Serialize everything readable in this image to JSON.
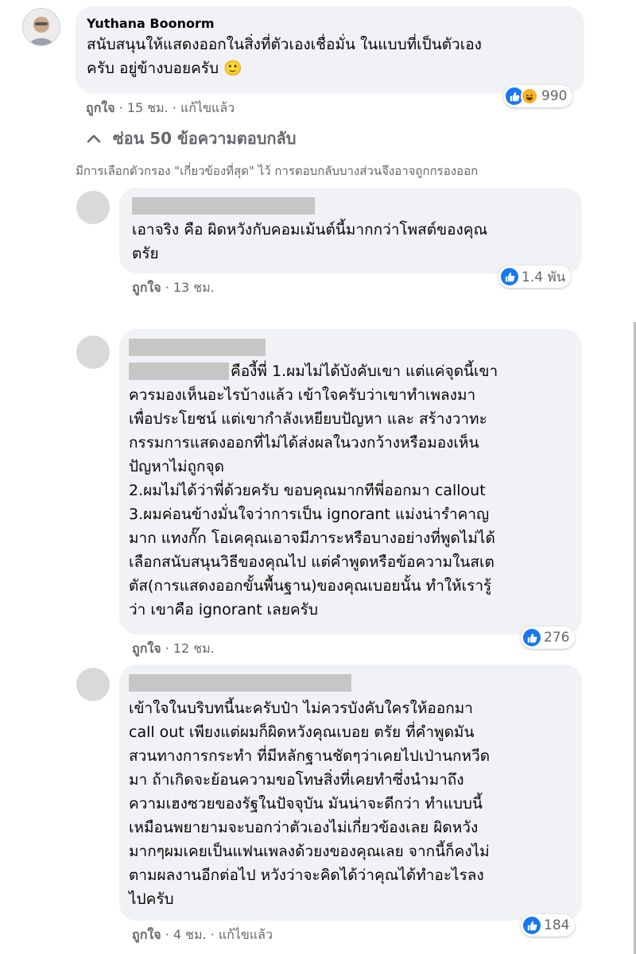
{
  "main_comment": {
    "author": "Yuthana Boonorm",
    "text": "สนับสนุนให้แสดงออกในสิ่งที่ตัวเองเชื่อมั่น ในแบบที่เป็นตัวเอง\nครับ อยู่ข้างบอยครับ",
    "emoji": "🙂",
    "like_label": "ถูกใจ",
    "time": "15 ชม.",
    "edited_label": "แก้ไขแล้ว",
    "reaction_count": "990",
    "reaction_icons": [
      "like-icon",
      "haha-icon"
    ]
  },
  "hide_replies_label": "ซ่อน 50 ข้อความตอบกลับ",
  "filter_note": "มีการเลือกตัวกรอง \"เกี่ยวข้องที่สุด\" ไว้ การตอบกลับบางส่วนจึงอาจถูกกรองออก",
  "replies": [
    {
      "text": "เอาจริง คือ ผิดหวังกับคอมเม้นต์นี้มากกว่าโพสต์ของคุณ\nตรัย",
      "like_label": "ถูกใจ",
      "time": "13 ชม.",
      "reaction_count": "1.4 พัน"
    },
    {
      "text_first": "คืองี้พี่ 1.ผมไม่ได้บังคับเขา แต่แค่จุดนี้เขา",
      "text": "ควรมองเห็นอะไรบ้างแล้ว เข้าใจครับว่าเขาทำเพลงมา\nเพื่อประโยชน์ แต่เขากำลังเหยียบปัญหา และ สร้างวาทะ\nกรรมการแสดงออกที่ไม่ได้ส่งผลในวงกว้างหรือมองเห็น\nปัญหาไม่ถูกจุด\n2.ผมไม่ได้ว่าพี่ด้วยครับ ขอบคุณมากทีพี่ออกมา callout\n3.ผมค่อนข้างมั่นใจว่าการเป็น ignorant แม่งน่ารำคาญ\nมาก แทงกั๊ก โอเคคุณเอาจมีภาระหรือบางอย่างที่พูดไม่ได้\nเลือกสนับสนุนวิธีของคุณไป แต่คำพูดหรือข้อความในสเต\nตัส(การแสดงออกขั้นพื้นฐาน)ของคุณเบอยนั้น ทำให้เรารู้\nว่า เขาคือ ignorant เลยครับ",
      "like_label": "ถูกใจ",
      "time": "12 ชม.",
      "reaction_count": "276"
    },
    {
      "text": "เข้าใจในบริบทนี้นะครับป๋า ไม่ควรบังคับใครให้ออกมา\ncall out เพียงแต่ผมก็ผิดหวังคุณเบอย ตรัย ที่คำพูดมัน\nสวนทางการกระทำ ที่มีหลักฐานชัดๆว่าเคยไปเป่านกหวีด\nมา ถ้าเกิดจะย้อนความขอโทษสิ่งที่เคยทำซึ่งนำมาถึง\nความเฮงซวยของรัฐในปัจจุบัน มันน่าจะดีกว่า ทำแบบนี้\nเหมือนพยายามจะบอกว่าตัวเองไม่เกี่ยวข้องเลย ผิดหวัง\nมากๆผมเคยเป็นแฟนเพลงด้วยงของคุณเลย จากนี้ก็คงไม่\nตามผลงานอีกต่อไป หวังว่าจะคิดได้ว่าคุณได้ทำอะไรลง\nไปครับ",
      "like_label": "ถูกใจ",
      "time": "4 ชม.",
      "edited_label": "แก้ไขแล้ว",
      "reaction_count": "184"
    }
  ],
  "colors": {
    "like_blue": "#1877f2",
    "bubble_bg": "#f0f2f5",
    "meta_gray": "#65676b",
    "haha_yellow": "#f7b125"
  }
}
